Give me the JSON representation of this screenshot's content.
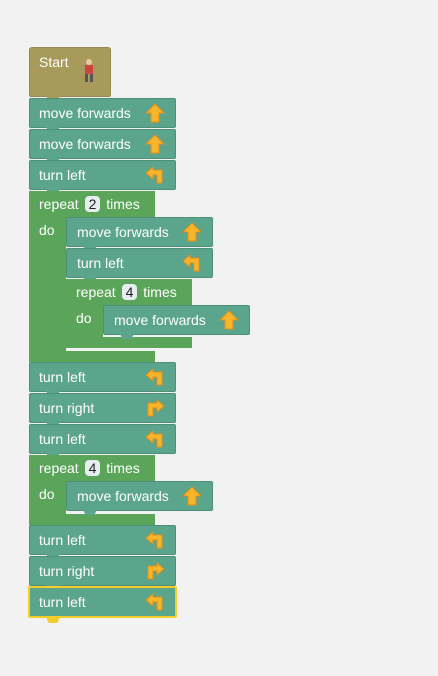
{
  "start": {
    "label": "Start"
  },
  "blocks": {
    "b1": {
      "label": "move forwards"
    },
    "b2": {
      "label": "move forwards"
    },
    "b3": {
      "label": "turn left"
    },
    "r1": {
      "repeat": "repeat",
      "times": "times",
      "count": "2",
      "do": "do"
    },
    "r1a": {
      "label": "move forwards"
    },
    "r1b": {
      "label": "turn left"
    },
    "r2": {
      "repeat": "repeat",
      "times": "times",
      "count": "4",
      "do": "do"
    },
    "r2a": {
      "label": "move forwards"
    },
    "b4": {
      "label": "turn left"
    },
    "b5": {
      "label": "turn right"
    },
    "b6": {
      "label": "turn left"
    },
    "r3": {
      "repeat": "repeat",
      "times": "times",
      "count": "4",
      "do": "do"
    },
    "r3a": {
      "label": "move forwards"
    },
    "b7": {
      "label": "turn left"
    },
    "b8": {
      "label": "turn right"
    },
    "b9": {
      "label": "turn left"
    }
  },
  "colors": {
    "background": "#f2f2f2",
    "action_block": "#5ba58c",
    "loop_block": "#5ba55b",
    "start_block": "#a89a5a",
    "selection": "#f4cd2b",
    "arrow_icon": "#f7b52b"
  },
  "icons": {
    "forward": "arrow-up-icon",
    "left": "turn-left-icon",
    "right": "turn-right-icon",
    "start": "pegman-icon"
  }
}
